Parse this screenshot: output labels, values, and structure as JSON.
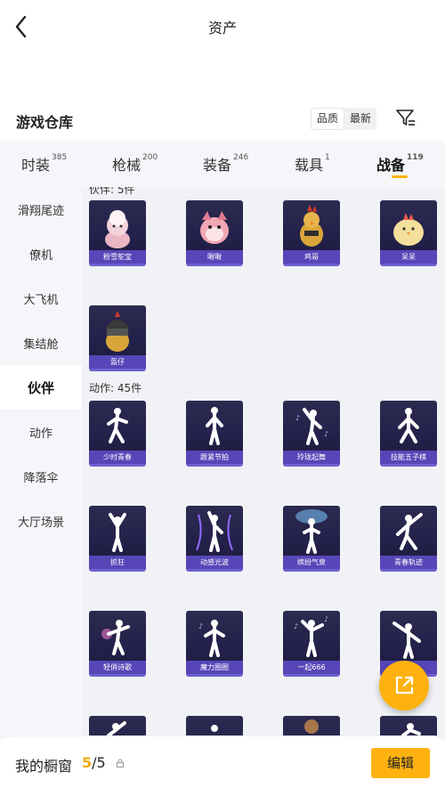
{
  "header": {
    "title": "资产"
  },
  "warehouse": {
    "title": "游戏仓库",
    "sort": [
      "品质",
      "最新"
    ]
  },
  "categories": [
    {
      "label": "时装",
      "count": "385"
    },
    {
      "label": "枪械",
      "count": "200"
    },
    {
      "label": "装备",
      "count": "246"
    },
    {
      "label": "载具",
      "count": "1"
    },
    {
      "label": "战备",
      "count": "119"
    }
  ],
  "sidebar": [
    "滑翔尾迹",
    "僚机",
    "大飞机",
    "集结舱",
    "伙伴",
    "动作",
    "降落伞",
    "大厅场景"
  ],
  "sections": {
    "partners": {
      "label": "伙伴: 5件",
      "items": [
        "粉雪鸵宝",
        "啾啾",
        "鸡哥",
        "呆呆",
        "盔仔"
      ]
    },
    "actions": {
      "label": "动作: 45件",
      "items": [
        "少时青春",
        "跟紧节拍",
        "玲珑起舞",
        "技能五子棋",
        "抓狂",
        "动感光波",
        "缤纷气泉",
        "青春轨迹",
        "轻俏诗歌",
        "魔力圈圈",
        "一起666",
        ""
      ]
    }
  },
  "showcase": {
    "label": "我的橱窗",
    "current": "5",
    "total": "/5",
    "edit": "编辑"
  },
  "colors": {
    "accent": "#ffb20f",
    "card_bg": "#2c2a4f",
    "card_caption": "#5746b8"
  }
}
